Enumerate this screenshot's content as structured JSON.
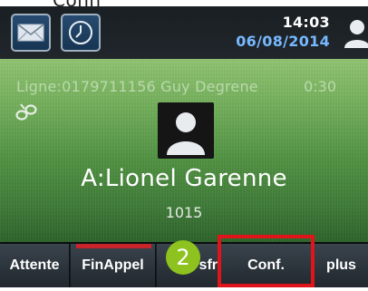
{
  "top_text": "Conn",
  "status_bar": {
    "time": "14:03",
    "date": "06/08/2014",
    "icons": [
      "envelope-icon",
      "clock-icon",
      "user-icon"
    ]
  },
  "call": {
    "line_info": "Ligne:0179711156 Guy Degrene",
    "duration": "0:30",
    "callee_name": "A:Lionel Garenne",
    "callee_number": "1015",
    "icons": [
      "link-icon",
      "contact-avatar-icon"
    ]
  },
  "softkeys": {
    "attente": "Attente",
    "fin_appel": "FinAppel",
    "transfert_partial": "sfr",
    "conf": "Conf.",
    "plus": "plus"
  },
  "annotation": {
    "step_number": "2",
    "badge_color": "#8dc21f",
    "highlight_color": "#e0151b"
  }
}
